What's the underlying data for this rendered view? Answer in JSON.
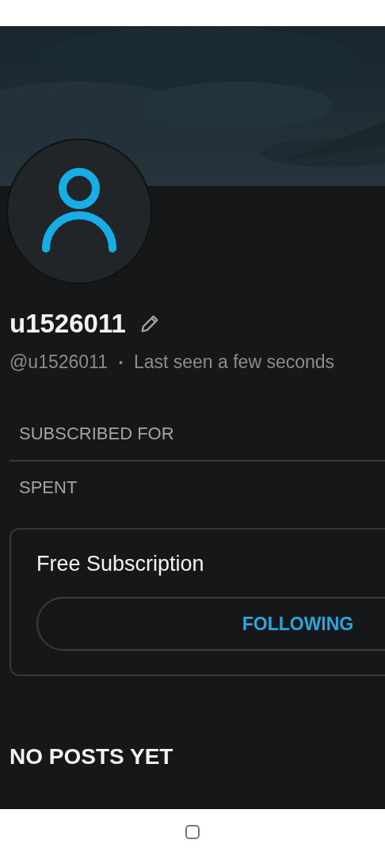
{
  "profile": {
    "name": "u1526011",
    "handle": "@u1526011",
    "separator": "•",
    "last_seen": "Last seen a few seconds"
  },
  "stats": [
    {
      "label": "SUBSCRIBED FOR"
    },
    {
      "label": "SPENT"
    }
  ],
  "subscription": {
    "title": "Free Subscription",
    "button": "FOLLOWING"
  },
  "posts_heading": "NO POSTS YET"
}
